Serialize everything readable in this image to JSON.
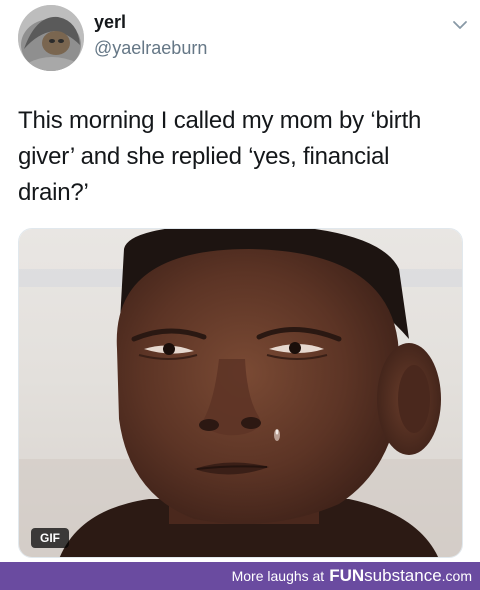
{
  "tweet": {
    "display_name": "yerl",
    "handle": "@yaelraeburn",
    "text": "This morning I called my mom by ‘birth giver’ and she replied ‘yes, financial drain?’",
    "media": {
      "badge": "GIF",
      "icon": "crying-boy-photo"
    },
    "menu_icon": "chevron-down-icon"
  },
  "footer": {
    "prefix": "More laughs at",
    "brand_fun": "FUN",
    "brand_name": "substance",
    "brand_tld": ".com",
    "background": "#6a4ba0"
  }
}
